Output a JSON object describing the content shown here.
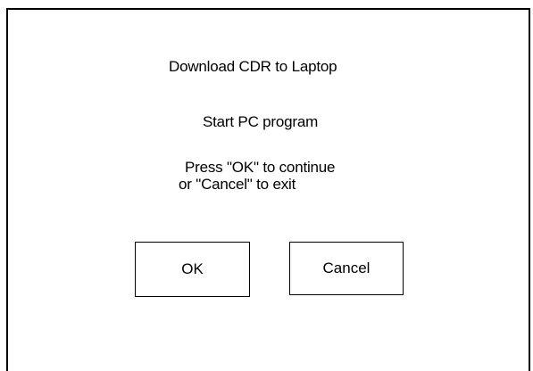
{
  "dialog": {
    "title": "Download CDR to Laptop",
    "subtitle": "Start PC program",
    "instruction_line1": "Press \"OK\" to continue",
    "instruction_line2": "or \"Cancel\" to exit",
    "ok_label": "OK",
    "cancel_label": "Cancel"
  },
  "colors": {
    "background": "#ffffff",
    "border": "#000000",
    "text": "#000000"
  }
}
